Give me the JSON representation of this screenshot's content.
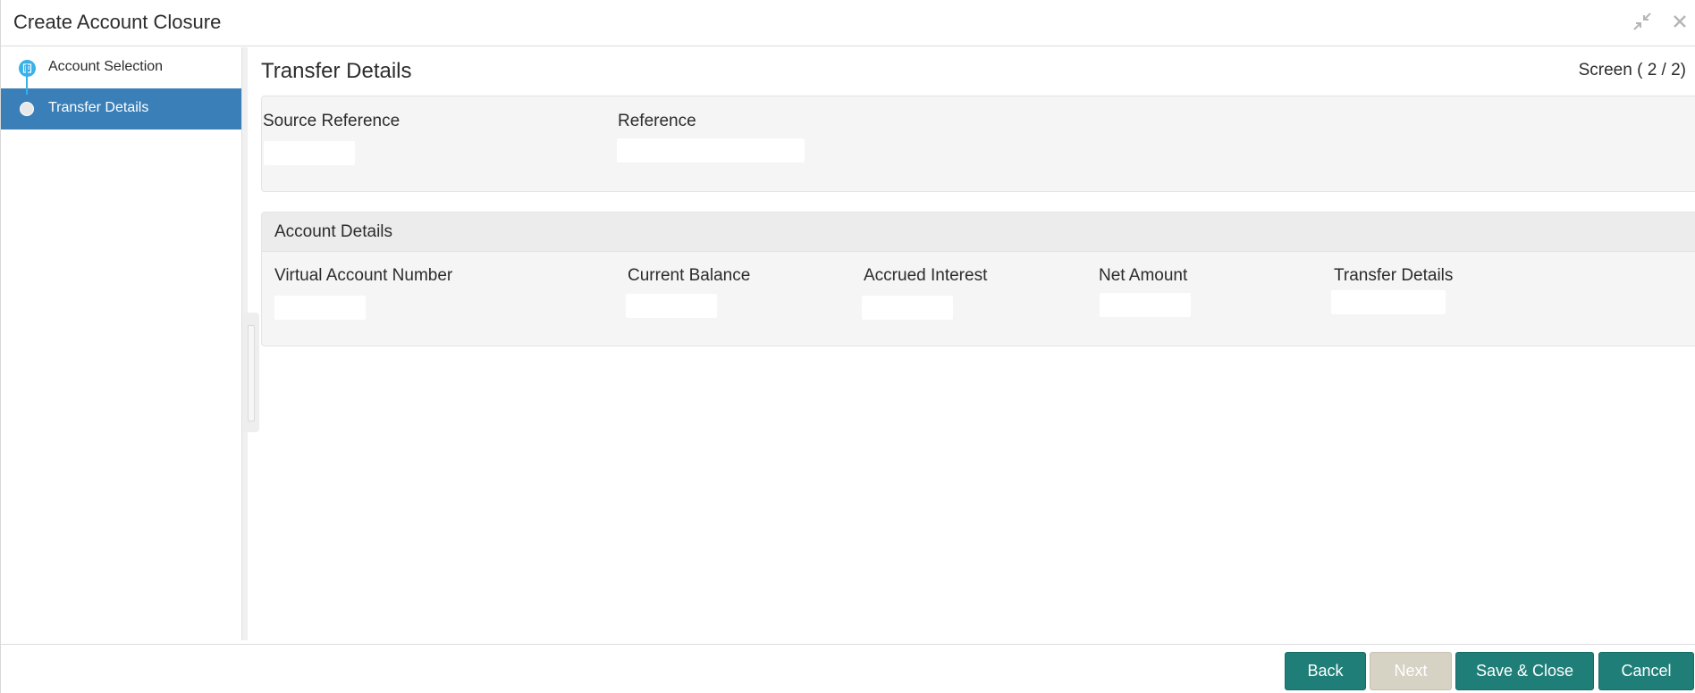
{
  "window": {
    "title": "Create Account Closure"
  },
  "sidebar": {
    "items": [
      {
        "label": "Account Selection",
        "state": "completed"
      },
      {
        "label": "Transfer Details",
        "state": "current"
      }
    ]
  },
  "main": {
    "section_title": "Transfer Details",
    "screen_counter": "Screen ( 2 / 2)",
    "reference_panel": {
      "source_reference_label": "Source Reference",
      "source_reference_value": "",
      "reference_label": "Reference",
      "reference_value": ""
    },
    "account_details": {
      "heading": "Account Details",
      "columns": [
        {
          "label": "Virtual Account Number",
          "value": ""
        },
        {
          "label": "Current Balance",
          "value": ""
        },
        {
          "label": "Accrued Interest",
          "value": ""
        },
        {
          "label": "Net Amount",
          "value": ""
        },
        {
          "label": "Transfer Details",
          "value": ""
        }
      ]
    }
  },
  "footer": {
    "back_label": "Back",
    "next_label": "Next",
    "save_close_label": "Save & Close",
    "cancel_label": "Cancel"
  },
  "colors": {
    "accent_active": "#3a7fb7",
    "step_indicator": "#3ab0e8",
    "button_primary": "#1f7f78",
    "button_disabled": "#d6d2c4"
  },
  "icons": {
    "minimize": "collapse-arrows-icon",
    "close": "close-icon",
    "step_done": "document-icon"
  }
}
